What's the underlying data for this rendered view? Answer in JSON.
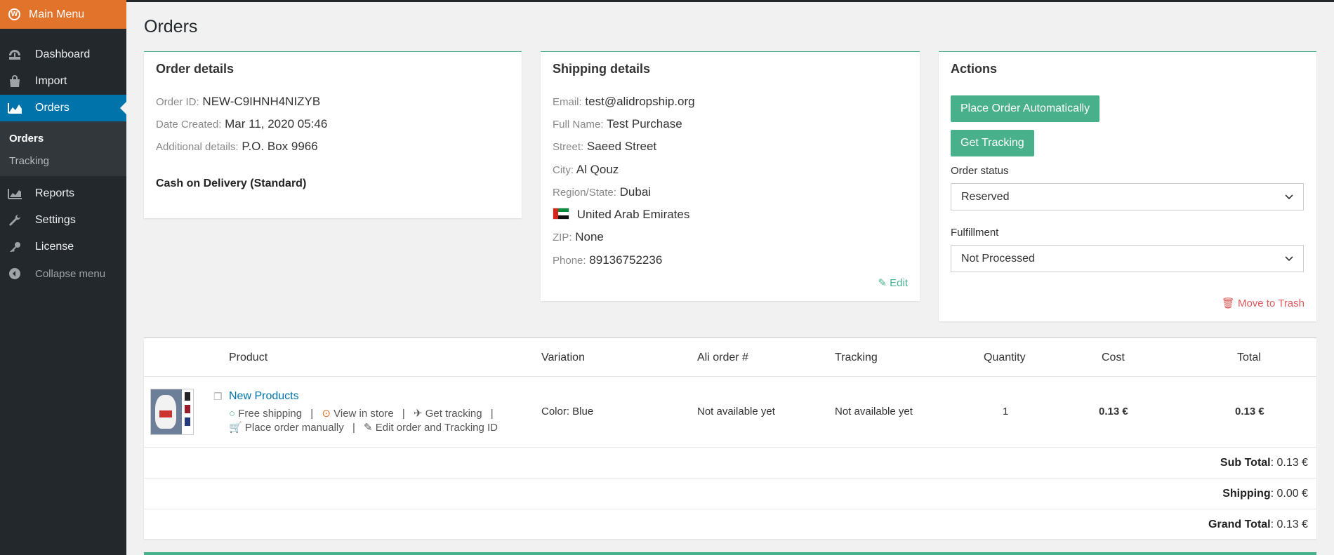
{
  "sidebar": {
    "main_menu": "Main Menu",
    "items": [
      {
        "label": "Dashboard",
        "icon": "dashboard-icon"
      },
      {
        "label": "Import",
        "icon": "import-icon"
      },
      {
        "label": "Orders",
        "icon": "orders-chart-icon"
      },
      {
        "label": "Reports",
        "icon": "reports-icon"
      },
      {
        "label": "Settings",
        "icon": "wrench-icon"
      },
      {
        "label": "License",
        "icon": "key-icon"
      }
    ],
    "submenu": [
      {
        "label": "Orders"
      },
      {
        "label": "Tracking"
      }
    ],
    "collapse_label": "Collapse menu"
  },
  "page": {
    "title": "Orders"
  },
  "order_details": {
    "title": "Order details",
    "order_id_label": "Order ID:",
    "order_id": "NEW-C9IHNH4NIZYB",
    "date_label": "Date Created:",
    "date": "Mar 11, 2020 05:46",
    "additional_label": "Additional details:",
    "additional": "P.O. Box 9966",
    "delivery": "Cash on Delivery (Standard)"
  },
  "shipping": {
    "title": "Shipping details",
    "email_label": "Email:",
    "email": "test@alidropship.org",
    "name_label": "Full Name:",
    "name": "Test Purchase",
    "street_label": "Street:",
    "street": "Saeed Street",
    "city_label": "City:",
    "city": "Al Qouz",
    "region_label": "Region/State:",
    "region": "Dubai",
    "country": "United Arab Emirates",
    "zip_label": "ZIP:",
    "zip": "None",
    "phone_label": "Phone:",
    "phone": "89136752236",
    "edit": "Edit"
  },
  "actions": {
    "title": "Actions",
    "place_order": "Place Order Automatically",
    "get_tracking": "Get Tracking",
    "status_label": "Order status",
    "status_value": "Reserved",
    "fulfillment_label": "Fulfillment",
    "fulfillment_value": "Not Processed",
    "trash": "Move to Trash"
  },
  "table": {
    "headers": {
      "product": "Product",
      "variation": "Variation",
      "ali": "Ali order #",
      "tracking": "Tracking",
      "quantity": "Quantity",
      "cost": "Cost",
      "total": "Total"
    },
    "rows": [
      {
        "product": "New Products",
        "free_shipping": "Free shipping",
        "view_store": "View in store",
        "get_tracking": "Get tracking",
        "place_manual": "Place order manually",
        "edit_order": "Edit order and Tracking ID",
        "variation": "Color: Blue",
        "ali": "Not available yet",
        "tracking": "Not available yet",
        "quantity": "1",
        "cost": "0.13 €",
        "total": "0.13 €"
      }
    ],
    "subtotal_label": "Sub Total",
    "subtotal": ": 0.13 €",
    "shipping_label": "Shipping",
    "shipping": ": 0.00 €",
    "grand_label": "Grand Total",
    "grand": ": 0.13 €"
  },
  "colors": {
    "accent": "#48b08b",
    "wp_orange": "#e2732a",
    "active_blue": "#0073aa",
    "danger": "#e05a5a"
  }
}
